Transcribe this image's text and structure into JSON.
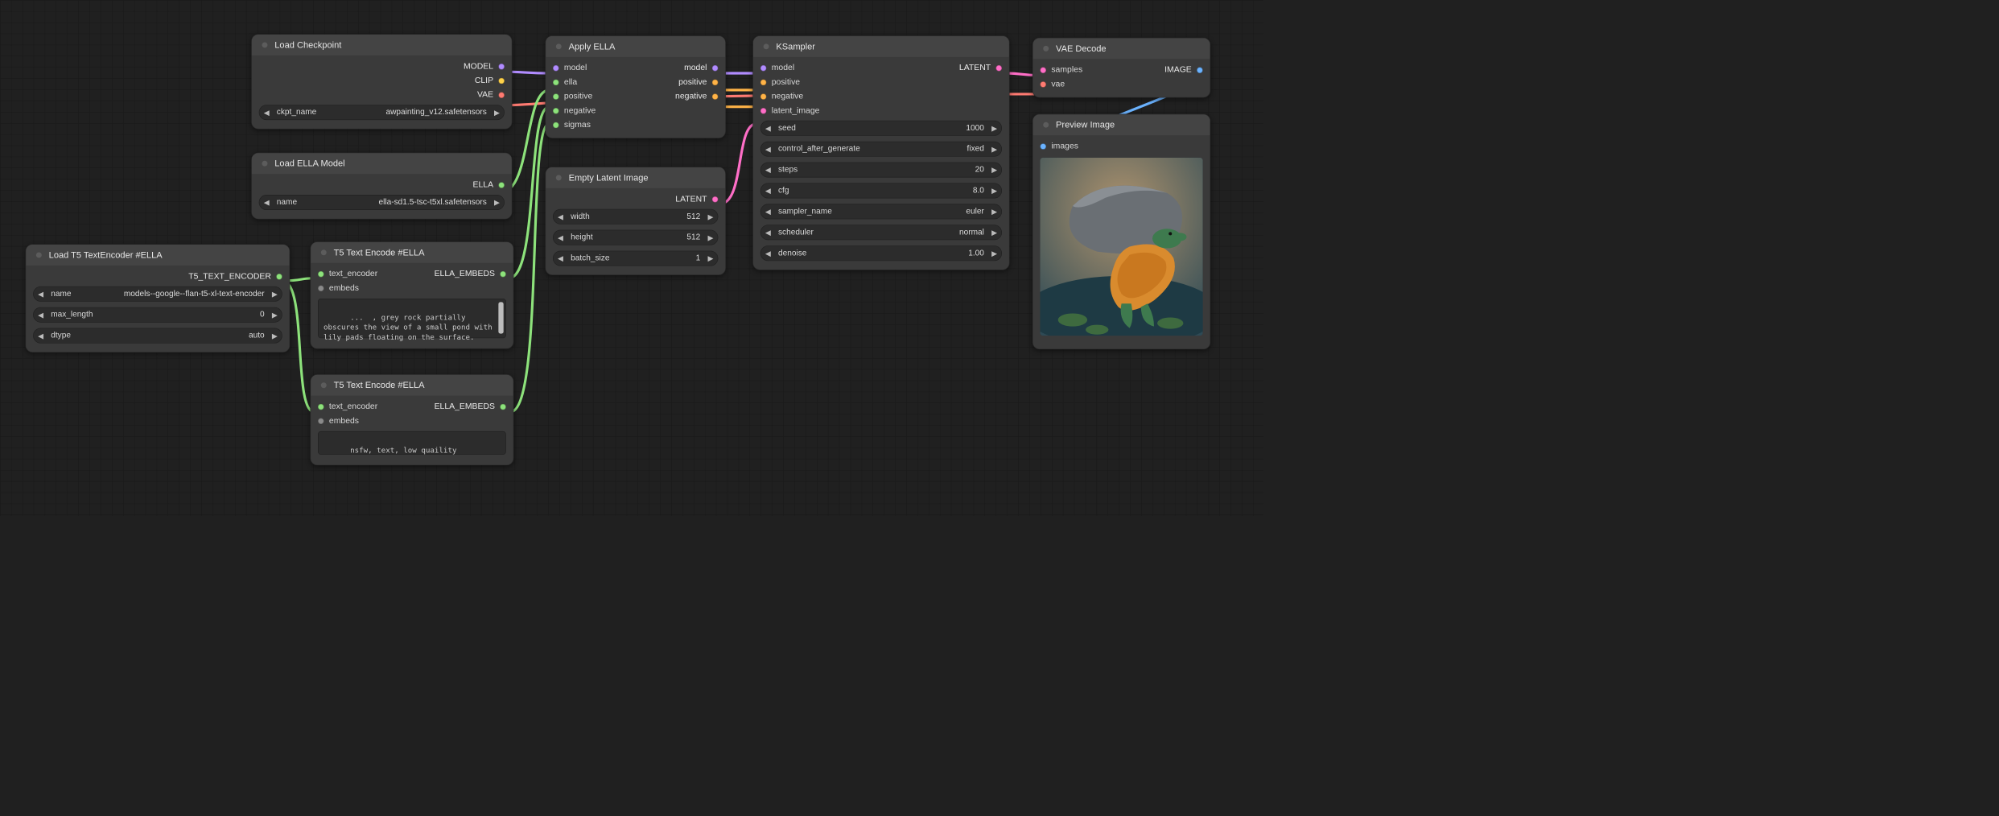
{
  "nodes": {
    "load_checkpoint": {
      "title": "Load Checkpoint",
      "outputs": {
        "model": "MODEL",
        "clip": "CLIP",
        "vae": "VAE"
      },
      "widgets": {
        "ckpt_name_label": "ckpt_name",
        "ckpt_name_value": "awpainting_v12.safetensors"
      }
    },
    "load_ella": {
      "title": "Load ELLA Model",
      "outputs": {
        "ella": "ELLA"
      },
      "widgets": {
        "name_label": "name",
        "name_value": "ella-sd1.5-tsc-t5xl.safetensors"
      }
    },
    "load_t5": {
      "title": "Load T5 TextEncoder #ELLA",
      "outputs": {
        "enc": "T5_TEXT_ENCODER"
      },
      "widgets": {
        "name_label": "name",
        "name_value": "models--google--flan-t5-xl-text-encoder",
        "max_length_label": "max_length",
        "max_length_value": "0",
        "dtype_label": "dtype",
        "dtype_value": "auto"
      }
    },
    "t5_encode_pos": {
      "title": "T5 Text Encode #ELLA",
      "inputs": {
        "text_encoder": "text_encoder",
        "embeds": "embeds"
      },
      "outputs": {
        "ella_embeds": "ELLA_EMBEDS"
      },
      "text": "...  , grey rock partially obscures the view of a small pond with lily pads floating on the surface."
    },
    "t5_encode_neg": {
      "title": "T5 Text Encode #ELLA",
      "inputs": {
        "text_encoder": "text_encoder",
        "embeds": "embeds"
      },
      "outputs": {
        "ella_embeds": "ELLA_EMBEDS"
      },
      "text": "nsfw, text, low quaility"
    },
    "apply_ella": {
      "title": "Apply ELLA",
      "inputs": {
        "model": "model",
        "ella": "ella",
        "positive": "positive",
        "negative": "negative",
        "sigmas": "sigmas"
      },
      "outputs": {
        "model": "model",
        "positive": "positive",
        "negative": "negative"
      }
    },
    "empty_latent": {
      "title": "Empty Latent Image",
      "outputs": {
        "latent": "LATENT"
      },
      "widgets": {
        "width_label": "width",
        "width_value": "512",
        "height_label": "height",
        "height_value": "512",
        "batch_label": "batch_size",
        "batch_value": "1"
      }
    },
    "ksampler": {
      "title": "KSampler",
      "inputs": {
        "model": "model",
        "positive": "positive",
        "negative": "negative",
        "latent_image": "latent_image"
      },
      "outputs": {
        "latent": "LATENT"
      },
      "widgets": {
        "seed_label": "seed",
        "seed_value": "1000",
        "cag_label": "control_after_generate",
        "cag_value": "fixed",
        "steps_label": "steps",
        "steps_value": "20",
        "cfg_label": "cfg",
        "cfg_value": "8.0",
        "sampler_label": "sampler_name",
        "sampler_value": "euler",
        "scheduler_label": "scheduler",
        "scheduler_value": "normal",
        "denoise_label": "denoise",
        "denoise_value": "1.00"
      }
    },
    "vae_decode": {
      "title": "VAE Decode",
      "inputs": {
        "samples": "samples",
        "vae": "vae"
      },
      "outputs": {
        "image": "IMAGE"
      }
    },
    "preview": {
      "title": "Preview Image",
      "inputs": {
        "images": "images"
      }
    }
  },
  "colors": {
    "model": "#b18cff",
    "clip": "#ffd24a",
    "vae": "#ff7b72",
    "green": "#8de27b",
    "latent": "#ff6ec7",
    "cond": "#ffb347",
    "image": "#6bb3ff"
  }
}
